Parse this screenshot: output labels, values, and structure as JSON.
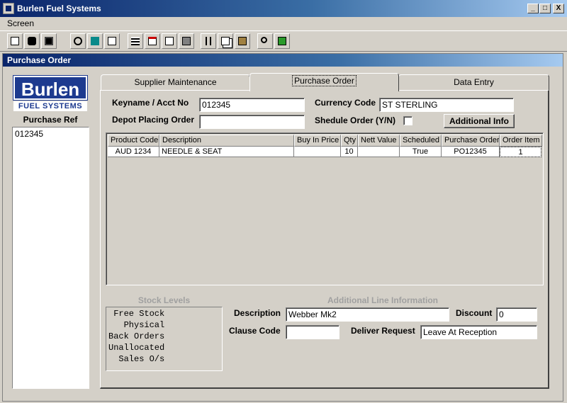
{
  "window": {
    "title": "Burlen Fuel Systems",
    "controls": [
      "_",
      "□",
      "X"
    ]
  },
  "menu": {
    "items": [
      "Screen"
    ]
  },
  "toolbar": {
    "buttons": [
      "new-icon",
      "find-icon",
      "save-icon",
      "undo-icon",
      "delete-icon",
      "page-icon",
      "calculator-icon",
      "card-icon",
      "chart-icon",
      "print-icon",
      "cut-icon",
      "copy-icon",
      "paste-icon",
      "search-icon",
      "exit-icon"
    ]
  },
  "child_window": {
    "title": "Purchase Order"
  },
  "left_panel": {
    "logo_top": "Burlen",
    "logo_bottom": "FUEL SYSTEMS",
    "purchase_ref_label": "Purchase Ref",
    "purchase_refs": [
      "012345"
    ]
  },
  "tabs": [
    {
      "label": "Supplier Maintenance",
      "active": false
    },
    {
      "label": "Purchase Order",
      "active": true
    },
    {
      "label": "Data Entry",
      "active": false
    }
  ],
  "form": {
    "keyname_label": "Keyname / Acct No",
    "keyname_value": "012345",
    "currency_label": "Currency Code",
    "currency_value": "ST STERLING",
    "depot_label": "Depot Placing Order",
    "depot_value": "",
    "schedule_label": "Shedule Order (Y/N)",
    "schedule_checked": false,
    "additional_info_button": "Additional Info"
  },
  "grid": {
    "columns": [
      "Product Code",
      "Description",
      "Buy In Price",
      "Qty",
      "Nett Value",
      "Scheduled",
      "Purchase Order",
      "Order Item"
    ],
    "rows": [
      [
        "AUD 1234",
        "NEEDLE & SEAT",
        "",
        "10",
        "",
        "True",
        "PO12345",
        "1"
      ]
    ]
  },
  "stock_levels": {
    "title": "Stock Levels",
    "lines": [
      " Free Stock",
      "   Physical",
      "Back Orders",
      "Unallocated",
      "  Sales O/s"
    ]
  },
  "additional_line": {
    "title": "Additional Line Information",
    "description_label": "Description",
    "description_value": "Webber Mk2",
    "discount_label": "Discount",
    "discount_value": "0",
    "clause_label": "Clause Code",
    "clause_value": "",
    "deliver_label": "Deliver Request",
    "deliver_value": "Leave At Reception"
  }
}
